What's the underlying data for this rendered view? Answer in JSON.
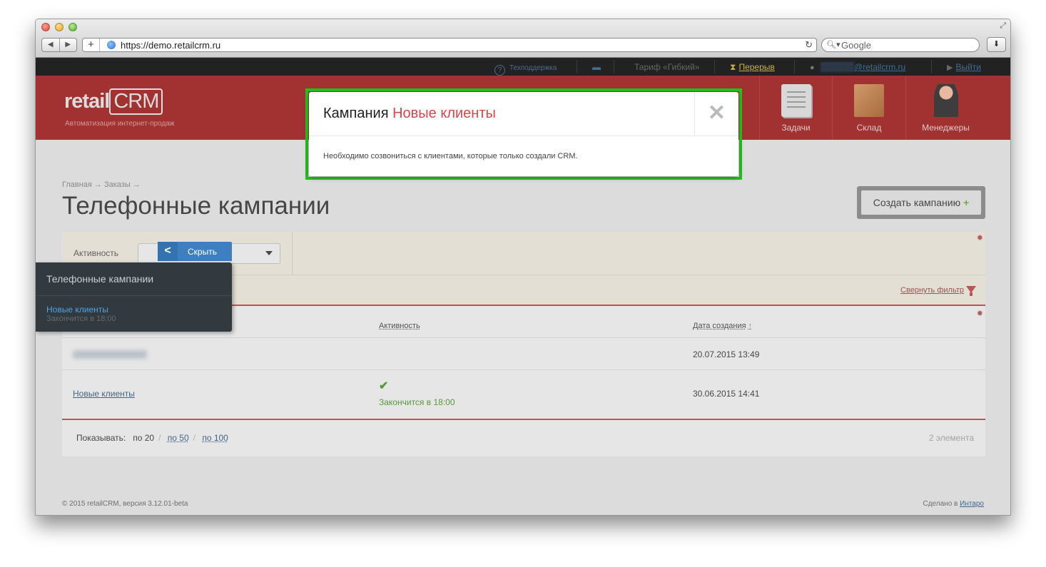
{
  "browser": {
    "url": "https://demo.retailcrm.ru",
    "search_placeholder": "Google"
  },
  "topbar": {
    "support": "Техподдержка",
    "tariff": "Тариф «Гибкий»",
    "break": "Перерыв",
    "email_blurred": "manager",
    "email_domain": "@retailcrm.ru",
    "logout": "Выйти"
  },
  "header": {
    "logo_retail": "retail",
    "logo_crm": "CRM",
    "tagline": "Автоматизация интернет-продаж",
    "nav": {
      "tasks": "Задачи",
      "store": "Склад",
      "managers": "Менеджеры"
    }
  },
  "breadcrumb": "Главная → Заказы →",
  "page_title": "Телефонные кампании",
  "create_button": "Создать кампанию",
  "create_button_icon": "+",
  "filter": {
    "activity_label": "Активность",
    "collapse_label": "Свернуть фильтр"
  },
  "table": {
    "headers": {
      "activity": "Активность",
      "created": "Дата создания"
    },
    "rows": [
      {
        "name": "",
        "activity": "",
        "created": "20.07.2015 13:49"
      },
      {
        "name": "Новые клиенты",
        "activity": "Закончится в 18:00",
        "created": "30.06.2015 14:41"
      }
    ]
  },
  "pager": {
    "show_label": "Показывать:",
    "current": "по 20",
    "opt_50": "по 50",
    "opt_100": "по 100",
    "count": "2 элемента"
  },
  "footer": {
    "copyright": "© 2015 retailCRM, версия 3.12.01-beta",
    "made_by": "Сделано в",
    "made_by_link": "Интаро"
  },
  "side_panel": {
    "hide_label": "Скрыть",
    "title": "Телефонные кампании",
    "item": "Новые клиенты",
    "item_sub": "Закончится в 18:00"
  },
  "modal": {
    "title_prefix": "Кампания",
    "title_accent": "Новые клиенты",
    "body": "Необходимо созвониться с клиентами, которые только создали CRM."
  }
}
